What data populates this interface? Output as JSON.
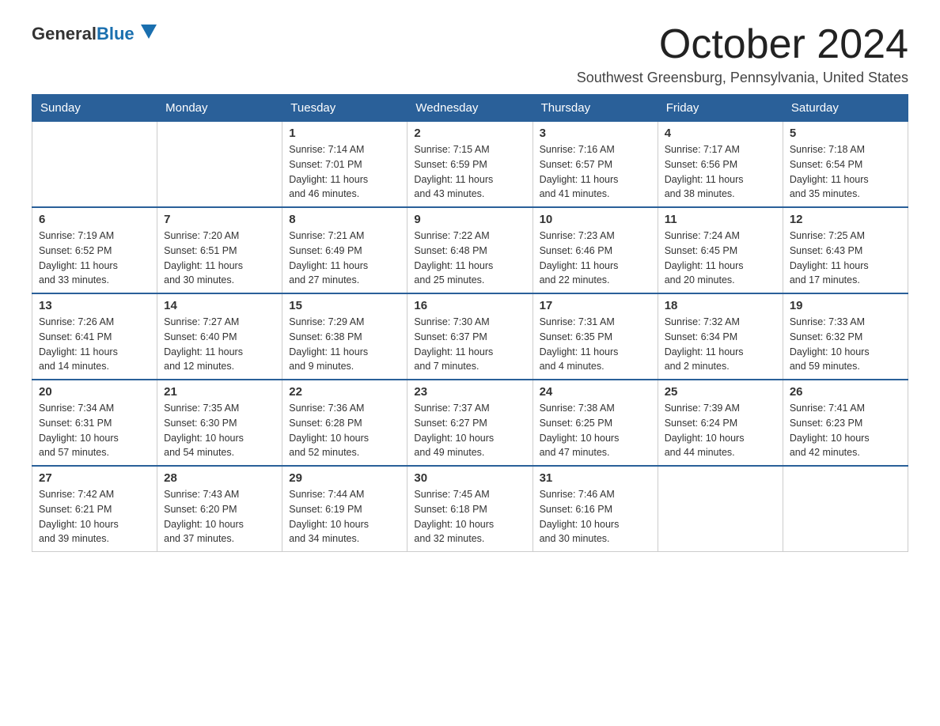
{
  "header": {
    "logo_general": "General",
    "logo_blue": "Blue",
    "month_title": "October 2024",
    "location": "Southwest Greensburg, Pennsylvania, United States"
  },
  "days_of_week": [
    "Sunday",
    "Monday",
    "Tuesday",
    "Wednesday",
    "Thursday",
    "Friday",
    "Saturday"
  ],
  "weeks": [
    [
      {
        "day": "",
        "info": ""
      },
      {
        "day": "",
        "info": ""
      },
      {
        "day": "1",
        "info": "Sunrise: 7:14 AM\nSunset: 7:01 PM\nDaylight: 11 hours\nand 46 minutes."
      },
      {
        "day": "2",
        "info": "Sunrise: 7:15 AM\nSunset: 6:59 PM\nDaylight: 11 hours\nand 43 minutes."
      },
      {
        "day": "3",
        "info": "Sunrise: 7:16 AM\nSunset: 6:57 PM\nDaylight: 11 hours\nand 41 minutes."
      },
      {
        "day": "4",
        "info": "Sunrise: 7:17 AM\nSunset: 6:56 PM\nDaylight: 11 hours\nand 38 minutes."
      },
      {
        "day": "5",
        "info": "Sunrise: 7:18 AM\nSunset: 6:54 PM\nDaylight: 11 hours\nand 35 minutes."
      }
    ],
    [
      {
        "day": "6",
        "info": "Sunrise: 7:19 AM\nSunset: 6:52 PM\nDaylight: 11 hours\nand 33 minutes."
      },
      {
        "day": "7",
        "info": "Sunrise: 7:20 AM\nSunset: 6:51 PM\nDaylight: 11 hours\nand 30 minutes."
      },
      {
        "day": "8",
        "info": "Sunrise: 7:21 AM\nSunset: 6:49 PM\nDaylight: 11 hours\nand 27 minutes."
      },
      {
        "day": "9",
        "info": "Sunrise: 7:22 AM\nSunset: 6:48 PM\nDaylight: 11 hours\nand 25 minutes."
      },
      {
        "day": "10",
        "info": "Sunrise: 7:23 AM\nSunset: 6:46 PM\nDaylight: 11 hours\nand 22 minutes."
      },
      {
        "day": "11",
        "info": "Sunrise: 7:24 AM\nSunset: 6:45 PM\nDaylight: 11 hours\nand 20 minutes."
      },
      {
        "day": "12",
        "info": "Sunrise: 7:25 AM\nSunset: 6:43 PM\nDaylight: 11 hours\nand 17 minutes."
      }
    ],
    [
      {
        "day": "13",
        "info": "Sunrise: 7:26 AM\nSunset: 6:41 PM\nDaylight: 11 hours\nand 14 minutes."
      },
      {
        "day": "14",
        "info": "Sunrise: 7:27 AM\nSunset: 6:40 PM\nDaylight: 11 hours\nand 12 minutes."
      },
      {
        "day": "15",
        "info": "Sunrise: 7:29 AM\nSunset: 6:38 PM\nDaylight: 11 hours\nand 9 minutes."
      },
      {
        "day": "16",
        "info": "Sunrise: 7:30 AM\nSunset: 6:37 PM\nDaylight: 11 hours\nand 7 minutes."
      },
      {
        "day": "17",
        "info": "Sunrise: 7:31 AM\nSunset: 6:35 PM\nDaylight: 11 hours\nand 4 minutes."
      },
      {
        "day": "18",
        "info": "Sunrise: 7:32 AM\nSunset: 6:34 PM\nDaylight: 11 hours\nand 2 minutes."
      },
      {
        "day": "19",
        "info": "Sunrise: 7:33 AM\nSunset: 6:32 PM\nDaylight: 10 hours\nand 59 minutes."
      }
    ],
    [
      {
        "day": "20",
        "info": "Sunrise: 7:34 AM\nSunset: 6:31 PM\nDaylight: 10 hours\nand 57 minutes."
      },
      {
        "day": "21",
        "info": "Sunrise: 7:35 AM\nSunset: 6:30 PM\nDaylight: 10 hours\nand 54 minutes."
      },
      {
        "day": "22",
        "info": "Sunrise: 7:36 AM\nSunset: 6:28 PM\nDaylight: 10 hours\nand 52 minutes."
      },
      {
        "day": "23",
        "info": "Sunrise: 7:37 AM\nSunset: 6:27 PM\nDaylight: 10 hours\nand 49 minutes."
      },
      {
        "day": "24",
        "info": "Sunrise: 7:38 AM\nSunset: 6:25 PM\nDaylight: 10 hours\nand 47 minutes."
      },
      {
        "day": "25",
        "info": "Sunrise: 7:39 AM\nSunset: 6:24 PM\nDaylight: 10 hours\nand 44 minutes."
      },
      {
        "day": "26",
        "info": "Sunrise: 7:41 AM\nSunset: 6:23 PM\nDaylight: 10 hours\nand 42 minutes."
      }
    ],
    [
      {
        "day": "27",
        "info": "Sunrise: 7:42 AM\nSunset: 6:21 PM\nDaylight: 10 hours\nand 39 minutes."
      },
      {
        "day": "28",
        "info": "Sunrise: 7:43 AM\nSunset: 6:20 PM\nDaylight: 10 hours\nand 37 minutes."
      },
      {
        "day": "29",
        "info": "Sunrise: 7:44 AM\nSunset: 6:19 PM\nDaylight: 10 hours\nand 34 minutes."
      },
      {
        "day": "30",
        "info": "Sunrise: 7:45 AM\nSunset: 6:18 PM\nDaylight: 10 hours\nand 32 minutes."
      },
      {
        "day": "31",
        "info": "Sunrise: 7:46 AM\nSunset: 6:16 PM\nDaylight: 10 hours\nand 30 minutes."
      },
      {
        "day": "",
        "info": ""
      },
      {
        "day": "",
        "info": ""
      }
    ]
  ]
}
